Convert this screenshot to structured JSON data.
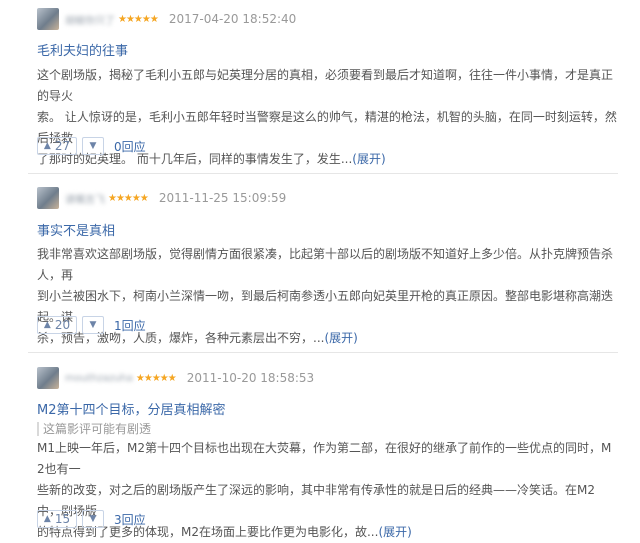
{
  "reviews": [
    {
      "username": "胡椒你只了",
      "stars": "★★★★★",
      "date": "2017-04-20 18:52:40",
      "title": "毛利夫妇的往事",
      "spoiler_note": "",
      "lines": [
        "这个剧场版，揭秘了毛利小五郎与妃英理分居的真相，必须要看到最后才知道啊，往往一件小事情，才是真正的导火",
        "索。 让人惊讶的是，毛利小五郎年轻时当警察是这么的帅气，精湛的枪法，机智的头脑，在同一时刻运转，然后拯救",
        "了那时的妃英理。 而十几年后，同样的事情发生了，发生..."
      ],
      "expand_label": "(展开)",
      "upvotes": "27",
      "reply_label": "0回应"
    },
    {
      "username": "请嘱吉飞",
      "stars": "★★★★★",
      "date": "2011-11-25 15:09:59",
      "title": "事实不是真相",
      "spoiler_note": "",
      "lines": [
        "我非常喜欢这部剧场版，觉得剧情方面很紧凑，比起第十部以后的剧场版不知道好上多少倍。从扑克牌预告杀人，再",
        "到小兰被困水下，柯南小兰深情一吻，到最后柯南参透小五郎向妃英里开枪的真正原因。整部电影堪称高潮迭起。谋",
        "杀，预告，激吻，人质，爆炸，各种元素层出不穷，..."
      ],
      "expand_label": "(展开)",
      "upvotes": "20",
      "reply_label": "1回应"
    },
    {
      "username": "mouthzazuha",
      "stars": "★★★★★",
      "date": "2011-10-20 18:58:53",
      "title": "M2第十四个目标，分居真相解密",
      "spoiler_note": "这篇影评可能有剧透",
      "lines": [
        "M1上映一年后，M2第十四个目标也出现在大荧幕，作为第二部，在很好的继承了前作的一些优点的同时，M2也有一",
        "些新的改变，对之后的剧场版产生了深远的影响，其中非常有传承性的就是日后的经典——冷笑话。在M2中，剧场版",
        "的特点得到了更多的体现，M2在场面上要比作更为电影化，故..."
      ],
      "expand_label": "(展开)",
      "upvotes": "15",
      "reply_label": "3回应"
    }
  ],
  "icons": {
    "upvote": "▲",
    "downvote": "▼"
  },
  "colors": {
    "title_link": "#3b68a8",
    "star": "#f5a623",
    "date": "#999999",
    "body_text": "#555555"
  }
}
